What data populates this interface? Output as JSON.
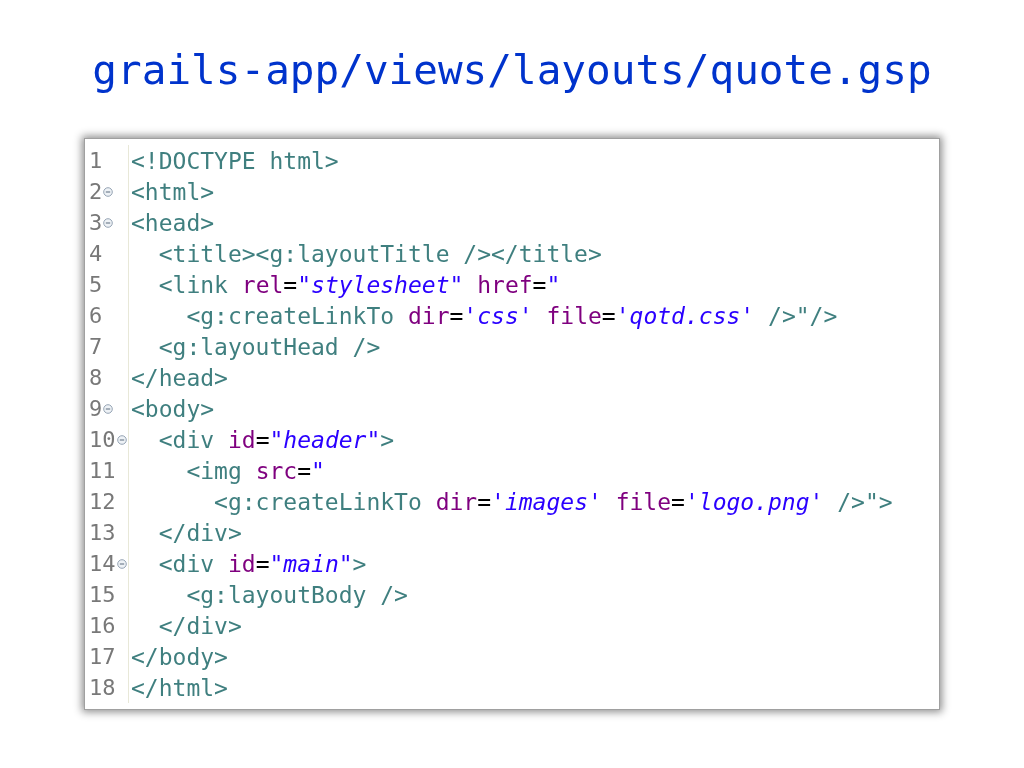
{
  "slide_title": "grails-app/views/layouts/quote.gsp",
  "editor": {
    "lines": [
      {
        "number": "1",
        "foldable": false,
        "tokens": [
          {
            "kind": "tag",
            "text": "<!DOCTYPE html>"
          }
        ]
      },
      {
        "number": "2",
        "foldable": true,
        "tokens": [
          {
            "kind": "tag",
            "text": "<html>"
          }
        ]
      },
      {
        "number": "3",
        "foldable": true,
        "tokens": [
          {
            "kind": "tag",
            "text": "<head>"
          }
        ]
      },
      {
        "number": "4",
        "foldable": false,
        "tokens": [
          {
            "kind": "tag",
            "text": "  <title><g:layoutTitle /></title>"
          }
        ]
      },
      {
        "number": "5",
        "foldable": false,
        "tokens": [
          {
            "kind": "tag",
            "text": "  <link "
          },
          {
            "kind": "attr",
            "text": "rel"
          },
          {
            "kind": "eq",
            "text": "="
          },
          {
            "kind": "str",
            "text": "\"stylesheet\""
          },
          {
            "kind": "attr",
            "text": " href"
          },
          {
            "kind": "eq",
            "text": "="
          },
          {
            "kind": "str",
            "text": "\""
          }
        ]
      },
      {
        "number": "6",
        "foldable": false,
        "tokens": [
          {
            "kind": "tag",
            "text": "    <g:createLinkTo "
          },
          {
            "kind": "attr",
            "text": "dir"
          },
          {
            "kind": "eq",
            "text": "="
          },
          {
            "kind": "str",
            "text": "'css'"
          },
          {
            "kind": "attr",
            "text": " file"
          },
          {
            "kind": "eq",
            "text": "="
          },
          {
            "kind": "str",
            "text": "'qotd.css'"
          },
          {
            "kind": "tag",
            "text": " />\"/>"
          }
        ]
      },
      {
        "number": "7",
        "foldable": false,
        "tokens": [
          {
            "kind": "tag",
            "text": "  <g:layoutHead />"
          }
        ]
      },
      {
        "number": "8",
        "foldable": false,
        "tokens": [
          {
            "kind": "tag",
            "text": "</head>"
          }
        ]
      },
      {
        "number": "9",
        "foldable": true,
        "tokens": [
          {
            "kind": "tag",
            "text": "<body>"
          }
        ]
      },
      {
        "number": "10",
        "foldable": true,
        "tokens": [
          {
            "kind": "tag",
            "text": "  <div "
          },
          {
            "kind": "attr",
            "text": "id"
          },
          {
            "kind": "eq",
            "text": "="
          },
          {
            "kind": "str",
            "text": "\"header\""
          },
          {
            "kind": "tag",
            "text": ">"
          }
        ]
      },
      {
        "number": "11",
        "foldable": false,
        "tokens": [
          {
            "kind": "tag",
            "text": "    <img "
          },
          {
            "kind": "attr",
            "text": "src"
          },
          {
            "kind": "eq",
            "text": "="
          },
          {
            "kind": "str",
            "text": "\""
          }
        ]
      },
      {
        "number": "12",
        "foldable": false,
        "tokens": [
          {
            "kind": "tag",
            "text": "      <g:createLinkTo "
          },
          {
            "kind": "attr",
            "text": "dir"
          },
          {
            "kind": "eq",
            "text": "="
          },
          {
            "kind": "str",
            "text": "'images'"
          },
          {
            "kind": "attr",
            "text": " file"
          },
          {
            "kind": "eq",
            "text": "="
          },
          {
            "kind": "str",
            "text": "'logo.png'"
          },
          {
            "kind": "tag",
            "text": " />\">"
          }
        ]
      },
      {
        "number": "13",
        "foldable": false,
        "tokens": [
          {
            "kind": "tag",
            "text": "  </div>"
          }
        ]
      },
      {
        "number": "14",
        "foldable": true,
        "tokens": [
          {
            "kind": "tag",
            "text": "  <div "
          },
          {
            "kind": "attr",
            "text": "id"
          },
          {
            "kind": "eq",
            "text": "="
          },
          {
            "kind": "str",
            "text": "\"main\""
          },
          {
            "kind": "tag",
            "text": ">"
          }
        ]
      },
      {
        "number": "15",
        "foldable": false,
        "tokens": [
          {
            "kind": "tag",
            "text": "    <g:layoutBody />"
          }
        ]
      },
      {
        "number": "16",
        "foldable": false,
        "tokens": [
          {
            "kind": "tag",
            "text": "  </div>"
          }
        ]
      },
      {
        "number": "17",
        "foldable": false,
        "tokens": [
          {
            "kind": "tag",
            "text": "</body>"
          }
        ]
      },
      {
        "number": "18",
        "foldable": false,
        "tokens": [
          {
            "kind": "tag",
            "text": "</html>"
          }
        ]
      }
    ]
  }
}
